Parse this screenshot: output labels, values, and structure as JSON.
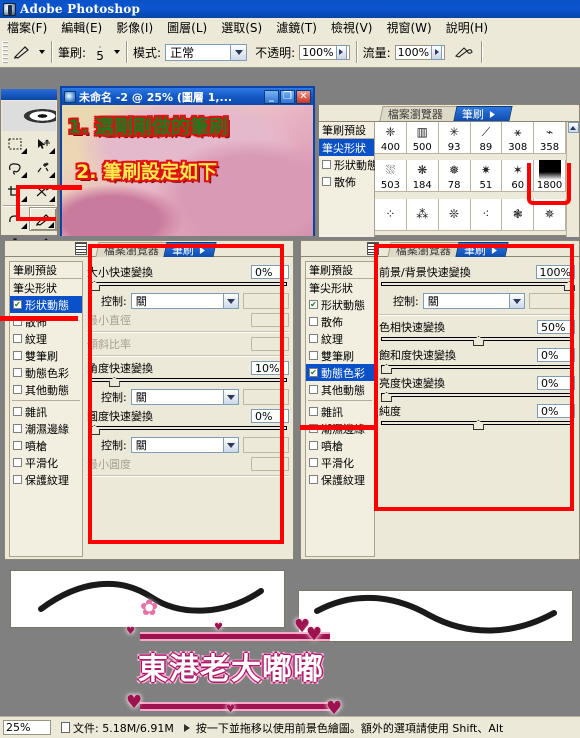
{
  "app": {
    "title": "Adobe Photoshop",
    "logo_icon": "photoshop-logo-icon"
  },
  "menubar": {
    "items": [
      {
        "label": "檔案(F)"
      },
      {
        "label": "編輯(E)"
      },
      {
        "label": "影像(I)"
      },
      {
        "label": "圖層(L)"
      },
      {
        "label": "選取(S)"
      },
      {
        "label": "濾鏡(T)"
      },
      {
        "label": "檢視(V)"
      },
      {
        "label": "視窗(W)"
      },
      {
        "label": "說明(H)"
      }
    ]
  },
  "options_bar": {
    "tool_icon": "paintbrush-icon",
    "brush_label": "筆刷:",
    "brush_size": "5",
    "mode_label": "模式:",
    "mode_value": "正常",
    "opacity_label": "不透明:",
    "opacity_value": "100%",
    "flow_label": "流量:",
    "flow_value": "100%",
    "airbrush_icon": "airbrush-icon"
  },
  "toolbox": {
    "tools": [
      {
        "name": "marquee-tool",
        "glyph": "▢"
      },
      {
        "name": "move-tool",
        "glyph": "✥"
      },
      {
        "name": "lasso-tool",
        "glyph": "⌇"
      },
      {
        "name": "magic-wand-tool",
        "glyph": "✳"
      },
      {
        "name": "crop-tool",
        "glyph": "⛶"
      },
      {
        "name": "slice-tool",
        "glyph": "✂"
      },
      {
        "name": "healing-brush-tool",
        "glyph": "◠"
      },
      {
        "name": "paintbrush-tool",
        "glyph": "🖌"
      },
      {
        "name": "stamp-tool",
        "glyph": "⛃"
      },
      {
        "name": "history-brush-tool",
        "glyph": "✎"
      }
    ],
    "selected_tool": "paintbrush-tool"
  },
  "document_window": {
    "title": "未命名 -2 @ 25% (圖層 1,...",
    "minimize": "_",
    "maximize": "❐",
    "close": "✕",
    "annotations": [
      {
        "text": "1. 選剛剛做的筆刷"
      },
      {
        "text": "2. 筆刷設定如下"
      }
    ]
  },
  "brush_palette_top": {
    "tabs": [
      {
        "label": "檔案瀏覽器",
        "active": false
      },
      {
        "label": "筆刷",
        "active": true
      }
    ],
    "tab_arrow_icon": "chevron-right-icon",
    "list": [
      {
        "label": "筆刷預設",
        "checkbox": false,
        "checked": false,
        "selected": false
      },
      {
        "label": "筆尖形狀",
        "checkbox": false,
        "checked": false,
        "selected": true
      },
      {
        "label": "形狀動態",
        "checkbox": true,
        "checked": false,
        "selected": false
      },
      {
        "label": "散佈",
        "checkbox": true,
        "checked": false,
        "selected": false
      }
    ],
    "grid": [
      {
        "num": "400"
      },
      {
        "num": "500"
      },
      {
        "num": "93"
      },
      {
        "num": "89"
      },
      {
        "num": "308"
      },
      {
        "num": "358"
      },
      {
        "num": "503"
      },
      {
        "num": "184"
      },
      {
        "num": "78"
      },
      {
        "num": "51"
      },
      {
        "num": "60"
      },
      {
        "num": "1800"
      }
    ],
    "highlighted_brush": "1800",
    "scroll_up_icon": "scroll-up-icon"
  },
  "shape_dynamics_panel": {
    "menu_icon": "palette-menu-icon",
    "tabs": [
      {
        "label": "檔案瀏覽器",
        "active": false
      },
      {
        "label": "筆刷",
        "active": true
      }
    ],
    "list": [
      {
        "label": "筆刷預設",
        "checkbox": false,
        "checked": false,
        "selected": false
      },
      {
        "label": "筆尖形狀",
        "checkbox": false,
        "checked": false,
        "selected": false
      },
      {
        "label": "形狀動態",
        "checkbox": true,
        "checked": true,
        "selected": true
      },
      {
        "label": "散佈",
        "checkbox": true,
        "checked": false,
        "selected": false
      },
      {
        "label": "紋理",
        "checkbox": true,
        "checked": false,
        "selected": false
      },
      {
        "label": "雙筆刷",
        "checkbox": true,
        "checked": false,
        "selected": false
      },
      {
        "label": "動態色彩",
        "checkbox": true,
        "checked": false,
        "selected": false
      },
      {
        "label": "其他動態",
        "checkbox": true,
        "checked": false,
        "selected": false
      },
      {
        "label": "雜訊",
        "checkbox": true,
        "checked": false,
        "selected": false
      },
      {
        "label": "潮濕邊緣",
        "checkbox": true,
        "checked": false,
        "selected": false
      },
      {
        "label": "噴槍",
        "checkbox": true,
        "checked": false,
        "selected": false
      },
      {
        "label": "平滑化",
        "checkbox": true,
        "checked": false,
        "selected": false
      },
      {
        "label": "保護紋理",
        "checkbox": true,
        "checked": false,
        "selected": false
      }
    ],
    "fields": [
      {
        "label": "大小快速變換",
        "value": "0%",
        "slider_pct": 0,
        "dim": false
      },
      {
        "label": "控制:",
        "value": "關",
        "type": "select"
      },
      {
        "label": "最小直徑",
        "value": "",
        "dim": true
      },
      {
        "label": "傾斜比率",
        "value": "",
        "dim": true
      },
      {
        "label": "角度快速變換",
        "value": "10%",
        "slider_pct": 10,
        "dim": false
      },
      {
        "label": "控制:",
        "value": "關",
        "type": "select"
      },
      {
        "label": "圓度快速變換",
        "value": "0%",
        "slider_pct": 0,
        "dim": false
      },
      {
        "label": "控制:",
        "value": "關",
        "type": "select"
      },
      {
        "label": "最小圓度",
        "value": "",
        "dim": true
      }
    ]
  },
  "color_dynamics_panel": {
    "menu_icon": "palette-menu-icon",
    "tabs": [
      {
        "label": "檔案瀏覽器",
        "active": false
      },
      {
        "label": "筆刷",
        "active": true
      }
    ],
    "list": [
      {
        "label": "筆刷預設",
        "checkbox": false,
        "checked": false,
        "selected": false
      },
      {
        "label": "筆尖形狀",
        "checkbox": false,
        "checked": false,
        "selected": false
      },
      {
        "label": "形狀動態",
        "checkbox": true,
        "checked": true,
        "selected": false
      },
      {
        "label": "散佈",
        "checkbox": true,
        "checked": false,
        "selected": false
      },
      {
        "label": "紋理",
        "checkbox": true,
        "checked": false,
        "selected": false
      },
      {
        "label": "雙筆刷",
        "checkbox": true,
        "checked": false,
        "selected": false
      },
      {
        "label": "動態色彩",
        "checkbox": true,
        "checked": true,
        "selected": true
      },
      {
        "label": "其他動態",
        "checkbox": true,
        "checked": false,
        "selected": false
      },
      {
        "label": "雜訊",
        "checkbox": true,
        "checked": false,
        "selected": false
      },
      {
        "label": "潮濕邊緣",
        "checkbox": true,
        "checked": false,
        "selected": false
      },
      {
        "label": "噴槍",
        "checkbox": true,
        "checked": false,
        "selected": false
      },
      {
        "label": "平滑化",
        "checkbox": true,
        "checked": false,
        "selected": false
      },
      {
        "label": "保護紋理",
        "checkbox": true,
        "checked": false,
        "selected": false
      }
    ],
    "fields": [
      {
        "label": "前景/背景快速變換",
        "value": "100%",
        "slider_pct": 100
      },
      {
        "label": "控制:",
        "value": "關",
        "type": "select"
      },
      {
        "label": "色相快速變換",
        "value": "50%",
        "slider_pct": 50
      },
      {
        "label": "飽和度快速變換",
        "value": "0%",
        "slider_pct": 0
      },
      {
        "label": "亮度快速變換",
        "value": "0%",
        "slider_pct": 0
      },
      {
        "label": "純度",
        "value": "0%",
        "slider_pct": 50
      }
    ]
  },
  "preview": {
    "left_stroke_name": "brush-stroke-preview",
    "right_stroke_name": "brush-stroke-preview"
  },
  "status_bar": {
    "zoom": "25%",
    "doc_icon": "document-icon",
    "doc_info": "文件: 5.18M/6.91M",
    "arrow_icon": "play-arrow-icon",
    "hint": "按一下並拖移以使用前景色繪圖。額外的選項請使用 Shift、Alt"
  },
  "watermark": {
    "text": "東港老大嘟嘟",
    "heart_glyph": "♥",
    "flower_glyph": "✿"
  },
  "colors": {
    "title_blue": "#0b52c8",
    "panel_bg": "#ece9d8",
    "selection_blue": "#0a50c8",
    "annotation_red": "#ff0000"
  }
}
